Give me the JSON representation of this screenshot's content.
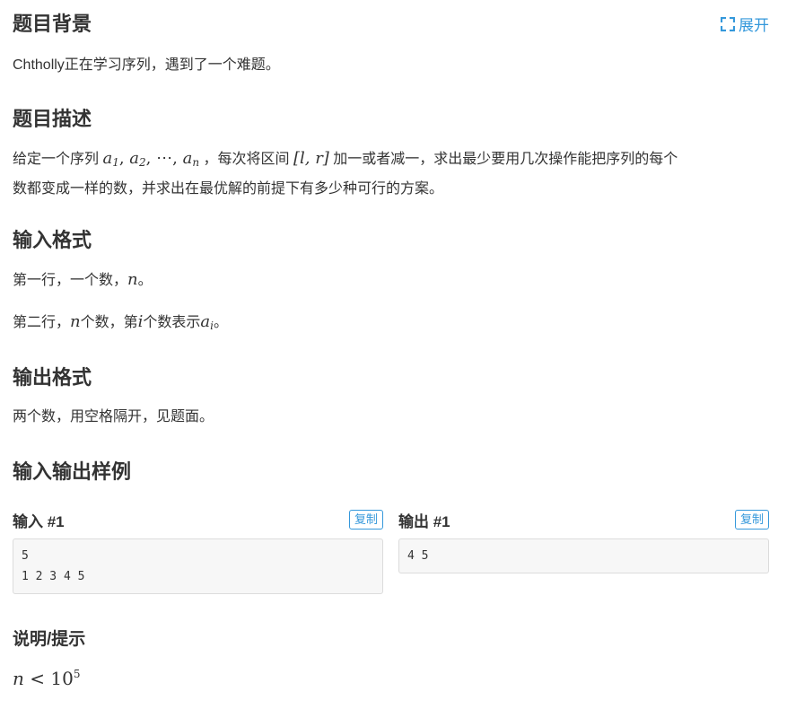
{
  "background": {
    "title": "题目背景",
    "expand_label": "展开",
    "text": "Chtholly正在学习序列，遇到了一个难题。"
  },
  "description": {
    "title": "题目描述",
    "line1_pre": "给定一个序列",
    "seq_a": "a",
    "seq_sub1": "1",
    "seq_sub2": "2",
    "seq_dots": "⋯",
    "seq_subn": "n",
    "line1_mid": "，每次将区间",
    "interval": "[l, r]",
    "line1_post": "加一或者减一，求出最少要用几次操作能把序列的每个",
    "line2": "数都变成一样的数，并求出在最优解的前提下有多少种可行的方案。"
  },
  "input_format": {
    "title": "输入格式",
    "line1_pre": "第一行，一个数，",
    "line1_var": "n",
    "line1_post": "。",
    "line2_pre": "第二行，",
    "line2_var_n": "n",
    "line2_mid1": "个数，第",
    "line2_var_i": "i",
    "line2_mid2": "个数表示",
    "line2_var_a": "a",
    "line2_sub_i": "i",
    "line2_post": "。"
  },
  "output_format": {
    "title": "输出格式",
    "text": "两个数，用空格隔开，见题面。"
  },
  "samples": {
    "title": "输入输出样例",
    "input_title": "输入 #1",
    "output_title": "输出 #1",
    "copy_label": "复制",
    "input_content": "5\n1 2 3 4 5",
    "output_content": "4 5"
  },
  "hint": {
    "title": "说明/提示",
    "var": "n",
    "op": "<",
    "base": "10",
    "exp": "5"
  },
  "colors": {
    "accent": "#3498db",
    "text": "#333333",
    "box_bg": "#f7f7f7"
  },
  "icons": {
    "expand": "fullscreen-expand-icon"
  }
}
